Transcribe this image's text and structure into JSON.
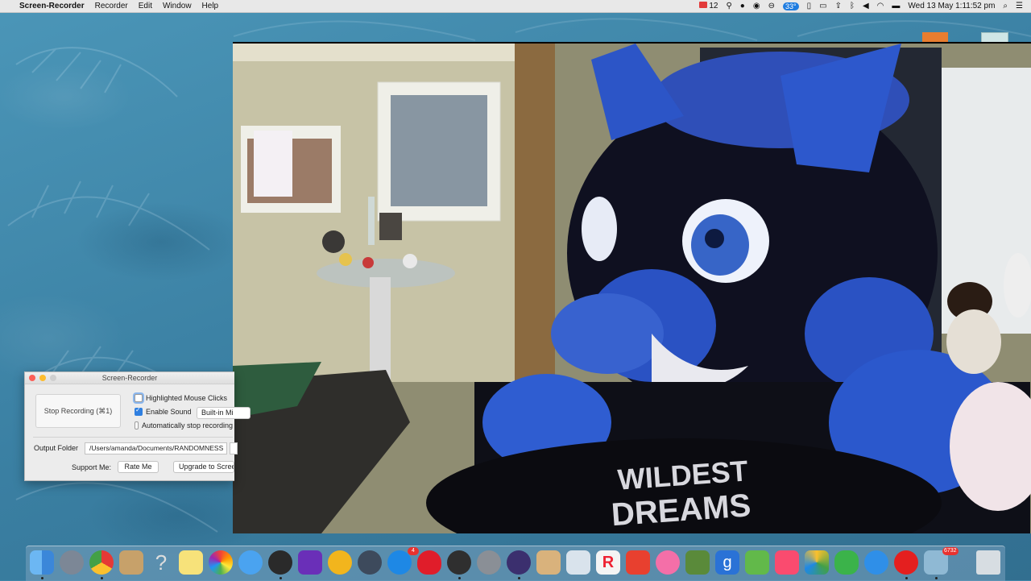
{
  "menubar": {
    "app_name": "Screen-Recorder",
    "menus": [
      "Recorder",
      "Edit",
      "Window",
      "Help"
    ],
    "mail_count": "12",
    "cpu_temp": "33°",
    "datetime": "Wed 13 May  1:11:52 pm"
  },
  "recorder": {
    "title": "Screen-Recorder",
    "stop_button": "Stop Recording (⌘1)",
    "highlighted_mouse_clicks": "Highlighted Mouse Clicks",
    "enable_sound": "Enable Sound",
    "sound_source": "Built-in Mi",
    "auto_stop": "Automatically stop recording",
    "output_folder_label": "Output Folder",
    "output_folder_value": "/Users/amanda/Documents/RANDOMNESS",
    "support_label": "Support Me:",
    "rate_button": "Rate Me",
    "upgrade_button": "Upgrade to Screen"
  },
  "video": {
    "shirt_text_line1": "WILDEST",
    "shirt_text_line2": "DREAMS"
  },
  "dock": {
    "badges": {
      "appstore": "4",
      "preview": "6732"
    }
  },
  "colors": {
    "wallpaper": "#3f86a8",
    "accent": "#2f7fe0",
    "badge": "#e8322f"
  }
}
